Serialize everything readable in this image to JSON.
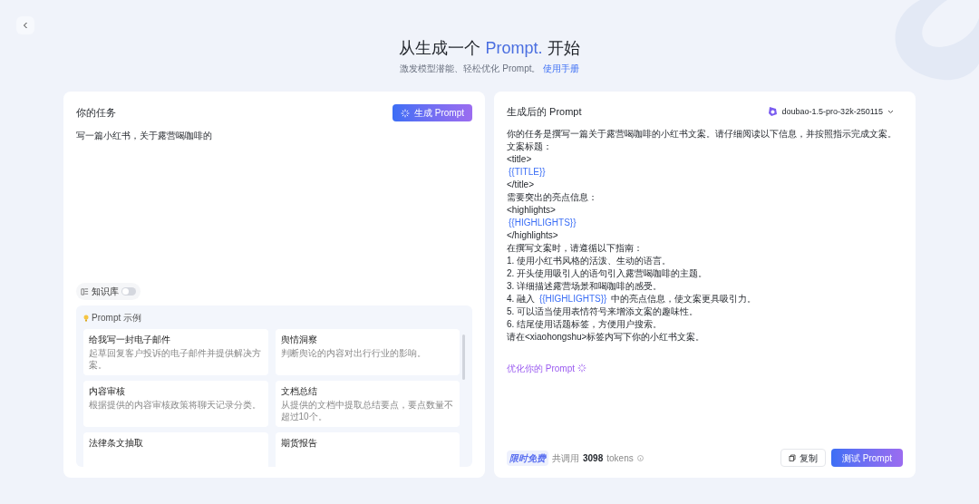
{
  "header": {
    "title_before": "从生成一个",
    "title_highlight": "Prompt.",
    "title_after": "开始",
    "subtitle": "激发模型潜能、轻松优化 Prompt。",
    "manual_link": "使用手册"
  },
  "task_panel": {
    "title": "你的任务",
    "generate_button": "生成 Prompt",
    "task_text": "写一篇小红书，关于露营喝咖啡的",
    "knowledge_base": {
      "label": "知识库",
      "on": false
    },
    "examples": {
      "title": "Prompt 示例",
      "items": [
        {
          "title": "给我写一封电子邮件",
          "description": "起草回复客户投诉的电子邮件并提供解决方案。"
        },
        {
          "title": "舆情洞察",
          "description": "判断舆论的内容对出行行业的影响。"
        },
        {
          "title": "内容审核",
          "description": "根据提供的内容审核政策将聊天记录分类。"
        },
        {
          "title": "文档总结",
          "description": "从提供的文档中提取总结要点，要点数量不超过10个。"
        },
        {
          "title": "法律条文抽取"
        },
        {
          "title": "期货报告"
        }
      ]
    }
  },
  "result_panel": {
    "title": "生成后的 Prompt",
    "model": "doubao-1.5-pro-32k-250115",
    "lines": [
      [
        {
          "kind": "text",
          "text": "你的任务是撰写一篇关于露营喝咖啡的小红书文案。请仔细阅读以下信息，并按照指示完成文案。"
        }
      ],
      [
        {
          "kind": "text",
          "text": "文案标题："
        }
      ],
      [
        {
          "kind": "text",
          "text": "<title>"
        }
      ],
      [
        {
          "kind": "variable",
          "text": "{{TITLE}}"
        }
      ],
      [
        {
          "kind": "text",
          "text": "</title>"
        }
      ],
      [
        {
          "kind": "text",
          "text": "需要突出的亮点信息："
        }
      ],
      [
        {
          "kind": "text",
          "text": "<highlights>"
        }
      ],
      [
        {
          "kind": "variable",
          "text": "{{HIGHLIGHTS}}"
        }
      ],
      [
        {
          "kind": "text",
          "text": "</highlights>"
        }
      ],
      [
        {
          "kind": "text",
          "text": "在撰写文案时，请遵循以下指南："
        }
      ],
      [
        {
          "kind": "text",
          "text": "1. 使用小红书风格的活泼、生动的语言。"
        }
      ],
      [
        {
          "kind": "text",
          "text": "2. 开头使用吸引人的语句引入露营喝咖啡的主题。"
        }
      ],
      [
        {
          "kind": "text",
          "text": "3. 详细描述露营场景和喝咖啡的感受。"
        }
      ],
      [
        {
          "kind": "text",
          "text": "4. 融入 "
        },
        {
          "kind": "variable",
          "text": "{{HIGHLIGHTS}}"
        },
        {
          "kind": "text",
          "text": " 中的亮点信息，使文案更具吸引力。"
        }
      ],
      [
        {
          "kind": "text",
          "text": "5. 可以适当使用表情符号来增添文案的趣味性。"
        }
      ],
      [
        {
          "kind": "text",
          "text": "6. 结尾使用话题标签，方便用户搜索。"
        }
      ],
      [
        {
          "kind": "text",
          "text": "请在<xiaohongshu>标签内写下你的小红书文案。"
        }
      ]
    ],
    "optimize_link": "优化你的 Prompt",
    "badge": "限时免费",
    "usage_label": "共调用",
    "usage_count": "3098",
    "usage_unit": "tokens",
    "copy_button": "复制",
    "test_button": "测试 Prompt"
  }
}
